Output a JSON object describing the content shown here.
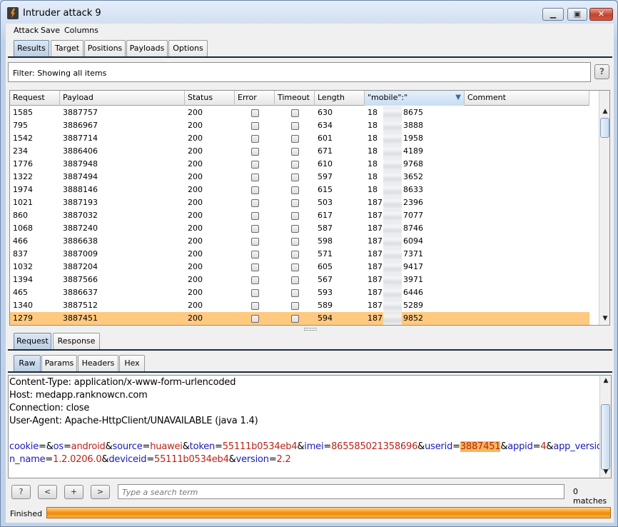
{
  "window": {
    "title": "Intruder attack 9"
  },
  "menu": [
    "Attack",
    "Save",
    "Columns"
  ],
  "main_tabs": [
    "Results",
    "Target",
    "Positions",
    "Payloads",
    "Options"
  ],
  "filter": {
    "label": "Filter:  Showing all items",
    "help": "?"
  },
  "table": {
    "columns": [
      "Request",
      "Payload",
      "Status",
      "Error",
      "Timeout",
      "Length",
      "\"mobile\":\"",
      "Comment"
    ],
    "rows": [
      {
        "request": "1585",
        "payload": "3887757",
        "status": "200",
        "length": "630",
        "mobile_a": "18",
        "mobile_b": "8675"
      },
      {
        "request": "795",
        "payload": "3886967",
        "status": "200",
        "length": "634",
        "mobile_a": "18",
        "mobile_b": "3888"
      },
      {
        "request": "1542",
        "payload": "3887714",
        "status": "200",
        "length": "601",
        "mobile_a": "18",
        "mobile_b": "1958"
      },
      {
        "request": "234",
        "payload": "3886406",
        "status": "200",
        "length": "671",
        "mobile_a": "18",
        "mobile_b": "4189"
      },
      {
        "request": "1776",
        "payload": "3887948",
        "status": "200",
        "length": "610",
        "mobile_a": "18",
        "mobile_b": "9768"
      },
      {
        "request": "1322",
        "payload": "3887494",
        "status": "200",
        "length": "597",
        "mobile_a": "18",
        "mobile_b": "3652"
      },
      {
        "request": "1974",
        "payload": "3888146",
        "status": "200",
        "length": "615",
        "mobile_a": "18",
        "mobile_b": "8633"
      },
      {
        "request": "1021",
        "payload": "3887193",
        "status": "200",
        "length": "503",
        "mobile_a": "187",
        "mobile_b": "2396"
      },
      {
        "request": "860",
        "payload": "3887032",
        "status": "200",
        "length": "617",
        "mobile_a": "187",
        "mobile_b": "7077"
      },
      {
        "request": "1068",
        "payload": "3887240",
        "status": "200",
        "length": "587",
        "mobile_a": "187",
        "mobile_b": "8746"
      },
      {
        "request": "466",
        "payload": "3886638",
        "status": "200",
        "length": "598",
        "mobile_a": "187",
        "mobile_b": "6094"
      },
      {
        "request": "837",
        "payload": "3887009",
        "status": "200",
        "length": "571",
        "mobile_a": "187",
        "mobile_b": "7371"
      },
      {
        "request": "1032",
        "payload": "3887204",
        "status": "200",
        "length": "605",
        "mobile_a": "187",
        "mobile_b": "9417"
      },
      {
        "request": "1394",
        "payload": "3887566",
        "status": "200",
        "length": "567",
        "mobile_a": "187",
        "mobile_b": "3971"
      },
      {
        "request": "465",
        "payload": "3886637",
        "status": "200",
        "length": "593",
        "mobile_a": "187",
        "mobile_b": "6446"
      },
      {
        "request": "1340",
        "payload": "3887512",
        "status": "200",
        "length": "589",
        "mobile_a": "187",
        "mobile_b": "5289"
      },
      {
        "request": "1279",
        "payload": "3887451",
        "status": "200",
        "length": "594",
        "mobile_a": "187",
        "mobile_b": "9852",
        "selected": true
      }
    ]
  },
  "detail_tabs": [
    "Request",
    "Response"
  ],
  "sub_tabs": [
    "Raw",
    "Params",
    "Headers",
    "Hex"
  ],
  "request_text": {
    "headers": [
      "Content-Type: application/x-www-form-urlencoded",
      "Host: medapp.ranknowcn.com",
      "Connection: close",
      "User-Agent: Apache-HttpClient/UNAVAILABLE (java 1.4)"
    ],
    "body_line1": [
      {
        "t": "p",
        "s": "cookie"
      },
      {
        "t": "d",
        "s": "=&"
      },
      {
        "t": "p",
        "s": "os"
      },
      {
        "t": "d",
        "s": "="
      },
      {
        "t": "v",
        "s": "android"
      },
      {
        "t": "d",
        "s": "&"
      },
      {
        "t": "p",
        "s": "source"
      },
      {
        "t": "d",
        "s": "="
      },
      {
        "t": "v",
        "s": "huawei"
      },
      {
        "t": "d",
        "s": "&"
      },
      {
        "t": "p",
        "s": "token"
      },
      {
        "t": "d",
        "s": "="
      },
      {
        "t": "v",
        "s": "55111b0534eb4"
      },
      {
        "t": "d",
        "s": "&"
      },
      {
        "t": "p",
        "s": "imei"
      },
      {
        "t": "d",
        "s": "="
      },
      {
        "t": "v",
        "s": "865585021358696"
      },
      {
        "t": "d",
        "s": "&"
      },
      {
        "t": "p",
        "s": "userid"
      },
      {
        "t": "d",
        "s": "="
      },
      {
        "t": "h",
        "s": "3887451"
      },
      {
        "t": "d",
        "s": "&"
      },
      {
        "t": "p",
        "s": "appid"
      },
      {
        "t": "d",
        "s": "="
      },
      {
        "t": "v",
        "s": "4"
      },
      {
        "t": "d",
        "s": "&"
      },
      {
        "t": "p",
        "s": "app_versio"
      }
    ],
    "body_line2": [
      {
        "t": "p",
        "s": "n_name"
      },
      {
        "t": "d",
        "s": "="
      },
      {
        "t": "v",
        "s": "1.2.0206.0"
      },
      {
        "t": "d",
        "s": "&"
      },
      {
        "t": "p",
        "s": "deviceid"
      },
      {
        "t": "d",
        "s": "="
      },
      {
        "t": "v",
        "s": "55111b0534eb4"
      },
      {
        "t": "d",
        "s": "&"
      },
      {
        "t": "p",
        "s": "version"
      },
      {
        "t": "d",
        "s": "="
      },
      {
        "t": "v",
        "s": "2.2"
      }
    ]
  },
  "search": {
    "placeholder": "Type a search term",
    "matches": "0 matches",
    "buttons": {
      "help": "?",
      "prev": "<",
      "add": "+",
      "next": ">"
    }
  },
  "status": {
    "text": "Finished",
    "progress": 1.0
  },
  "colors": {
    "selected_row": "#ffc980",
    "param_key": "#1a1ab8",
    "param_value": "#b8231a",
    "highlight": "#f6b85a",
    "progress": "#f59a18"
  }
}
